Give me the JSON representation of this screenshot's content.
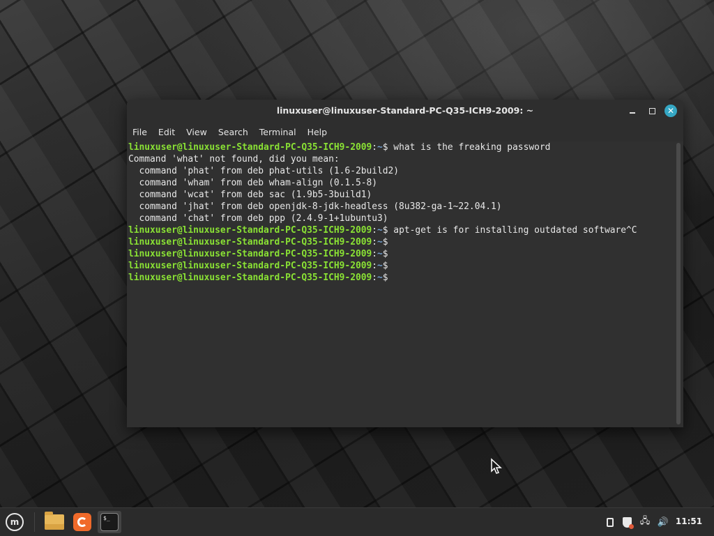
{
  "window": {
    "title": "linuxuser@linuxuser-Standard-PC-Q35-ICH9-2009: ~"
  },
  "menu": {
    "file": "File",
    "edit": "Edit",
    "view": "View",
    "search": "Search",
    "terminal": "Terminal",
    "help": "Help"
  },
  "terminal": {
    "prompt_user": "linuxuser@linuxuser-Standard-PC-Q35-ICH9-2009",
    "prompt_colon": ":",
    "prompt_path": "~",
    "prompt_dollar": "$",
    "lines": [
      {
        "type": "prompt",
        "cmd": " what is the freaking password"
      },
      {
        "type": "output",
        "text": "Command 'what' not found, did you mean:"
      },
      {
        "type": "output",
        "text": "  command 'phat' from deb phat-utils (1.6-2build2)"
      },
      {
        "type": "output",
        "text": "  command 'wham' from deb wham-align (0.1.5-8)"
      },
      {
        "type": "output",
        "text": "  command 'wcat' from deb sac (1.9b5-3build1)"
      },
      {
        "type": "output",
        "text": "  command 'jhat' from deb openjdk-8-jdk-headless (8u382-ga-1~22.04.1)"
      },
      {
        "type": "output",
        "text": "  command 'chat' from deb ppp (2.4.9-1+1ubuntu3)"
      },
      {
        "type": "prompt",
        "cmd": " apt-get is for installing outdated software^C"
      },
      {
        "type": "prompt",
        "cmd": ""
      },
      {
        "type": "prompt",
        "cmd": ""
      },
      {
        "type": "prompt",
        "cmd": ""
      },
      {
        "type": "prompt",
        "cmd": ""
      }
    ]
  },
  "taskbar": {
    "menu_icon": "linux-mint-logo-icon",
    "launchers": [
      "files-folder-icon",
      "firefox-icon",
      "terminal-icon"
    ],
    "terminal_icon_text": "$_",
    "tray_icons": [
      "clipboard-icon",
      "update-shield-icon",
      "network-icon",
      "volume-icon"
    ],
    "clock": "11:51"
  },
  "colors": {
    "prompt_green": "#8ae234",
    "path_blue": "#729fcf",
    "terminal_bg": "#303030",
    "close_button": "#35a7c4"
  }
}
